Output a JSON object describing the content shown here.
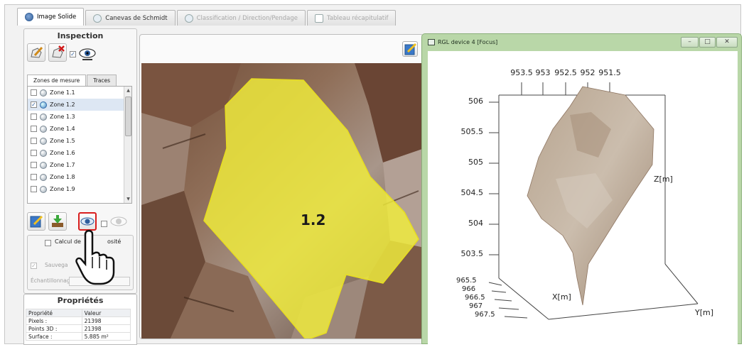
{
  "tabs": [
    {
      "label": "Image Solide",
      "active": true
    },
    {
      "label": "Canevas de Schmidt",
      "active": false
    },
    {
      "label": "Classification / Direction/Pendage",
      "active": false
    },
    {
      "label": "Tableau récapitulatif",
      "active": false
    }
  ],
  "inspection": {
    "title": "Inspection",
    "subtabs": [
      "Zones de mesure",
      "Traces"
    ],
    "zones": [
      {
        "label": "Zone 1.1",
        "checked": false,
        "selected": false
      },
      {
        "label": "Zone 1.2",
        "checked": true,
        "selected": true
      },
      {
        "label": "Zone 1.3",
        "checked": false,
        "selected": false
      },
      {
        "label": "Zone 1.4",
        "checked": false,
        "selected": false
      },
      {
        "label": "Zone 1.5",
        "checked": false,
        "selected": false
      },
      {
        "label": "Zone 1.6",
        "checked": false,
        "selected": false
      },
      {
        "label": "Zone 1.7",
        "checked": false,
        "selected": false
      },
      {
        "label": "Zone 1.8",
        "checked": false,
        "selected": false
      },
      {
        "label": "Zone 1.9",
        "checked": false,
        "selected": false
      }
    ]
  },
  "calc": {
    "label": "Calcul de",
    "label_tail": "osité",
    "save": "Sauvega",
    "sampling": "Échantillonnage :"
  },
  "properties": {
    "title": "Propriétés",
    "headers": [
      "Propriété",
      "Valeur"
    ],
    "rows": [
      [
        "Pixels :",
        "21398"
      ],
      [
        "Points 3D :",
        "21398"
      ],
      [
        "Surface :",
        "5.885 m²"
      ]
    ]
  },
  "image": {
    "zone_label": "1.2"
  },
  "rgl": {
    "title": "RGL device 4 [Focus]",
    "x_ticks": [
      "953.5",
      "953",
      "952.5",
      "952",
      "951.5"
    ],
    "z_ticks": [
      "506",
      "505.5",
      "505",
      "504.5",
      "504",
      "503.5"
    ],
    "front_ticks": [
      "965.5",
      "966",
      "966.5",
      "967",
      "967.5"
    ],
    "z_label": "Z[m]",
    "x_label": "X[m]",
    "y_label": "Y[m]"
  },
  "colors": {
    "zone_fill": "#f2ee3a",
    "window_frame": "#b9d7a8",
    "highlight_red": "#d81e1e"
  }
}
